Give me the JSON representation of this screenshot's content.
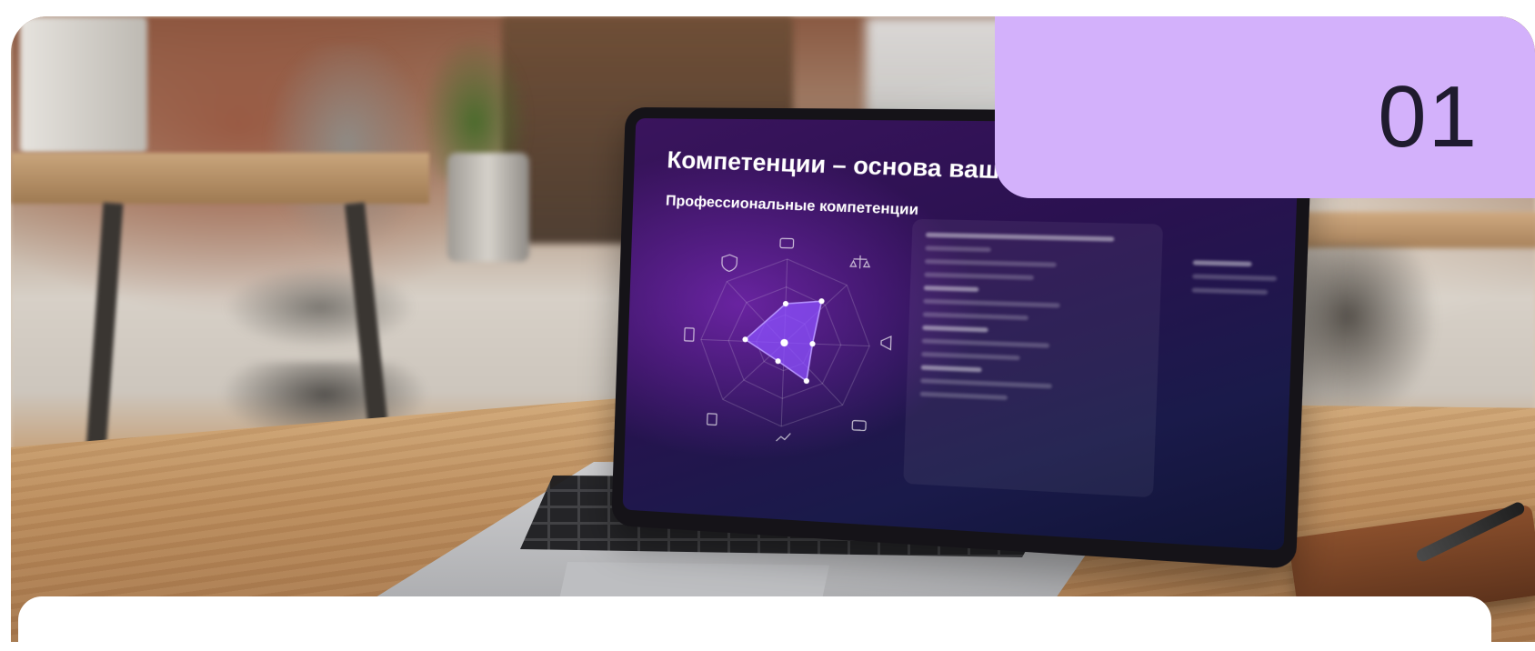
{
  "badge": {
    "number": "01"
  },
  "laptop_screen": {
    "title": "Компетенции – основа вашего бизнеса",
    "subtitle": "Профессиональные компетенции"
  },
  "colors": {
    "badge_bg": "#d3b1fb",
    "badge_text": "#1f1b2e",
    "screen_accent": "#7c3aed"
  },
  "icons": [
    "shield-icon",
    "printer-icon",
    "scales-icon",
    "megaphone-icon",
    "briefcase-icon",
    "chart-icon",
    "documents-icon",
    "calculator-icon"
  ]
}
